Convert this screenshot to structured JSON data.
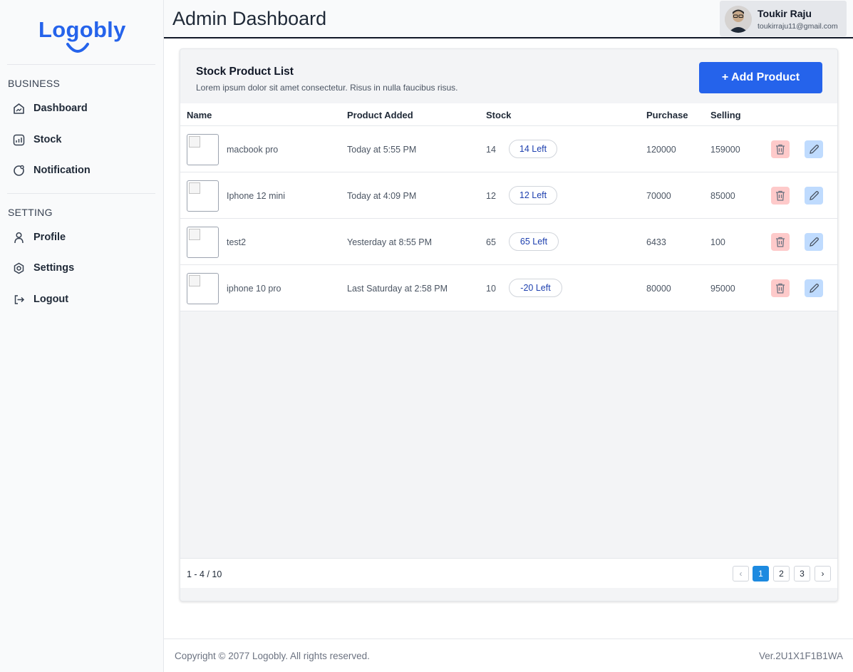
{
  "brand": {
    "logo_text": "Logobly"
  },
  "sidebar": {
    "sections": [
      {
        "title": "BUSINESS",
        "items": [
          {
            "label": "Dashboard",
            "icon": "dashboard-icon"
          },
          {
            "label": "Stock",
            "icon": "stock-icon"
          },
          {
            "label": "Notification",
            "icon": "notification-icon"
          }
        ]
      },
      {
        "title": "SETTING",
        "items": [
          {
            "label": "Profile",
            "icon": "user-icon"
          },
          {
            "label": "Settings",
            "icon": "settings-icon"
          },
          {
            "label": "Logout",
            "icon": "logout-icon"
          }
        ]
      }
    ]
  },
  "header": {
    "title": "Admin Dashboard",
    "user": {
      "name": "Toukir Raju",
      "email": "toukirraju11@gmail.com"
    }
  },
  "card": {
    "title": "Stock Product List",
    "subtitle": "Lorem ipsum dolor sit amet consectetur. Risus in nulla faucibus risus.",
    "add_button": "+ Add Product"
  },
  "table": {
    "columns": {
      "name": "Name",
      "added": "Product Added",
      "stock": "Stock",
      "purchase": "Purchase",
      "selling": "Selling"
    },
    "rows": [
      {
        "name": "macbook pro",
        "added": "Today at 5:55 PM",
        "stock": "14",
        "left": "14 Left",
        "purchase": "120000",
        "selling": "159000"
      },
      {
        "name": "Iphone 12 mini",
        "added": "Today at 4:09 PM",
        "stock": "12",
        "left": "12 Left",
        "purchase": "70000",
        "selling": "85000"
      },
      {
        "name": "test2",
        "added": "Yesterday at 8:55 PM",
        "stock": "65",
        "left": "65 Left",
        "purchase": "6433",
        "selling": "100"
      },
      {
        "name": "iphone 10 pro",
        "added": "Last Saturday at 2:58 PM",
        "stock": "10",
        "left": "-20 Left",
        "purchase": "80000",
        "selling": "95000"
      }
    ]
  },
  "pagination": {
    "range": "1 - 4 / 10",
    "prev": "‹",
    "next": "›",
    "pages": [
      "1",
      "2",
      "3"
    ],
    "current": "1"
  },
  "footer": {
    "copyright": "Copyright © 2077 Logobly. All rights reserved.",
    "version": "Ver.2U1X1F1B1WA"
  },
  "colors": {
    "accent": "#2563eb",
    "delete_bg": "#fecaca",
    "edit_bg": "#bfdbfe",
    "page_active": "#1d8ae0"
  }
}
